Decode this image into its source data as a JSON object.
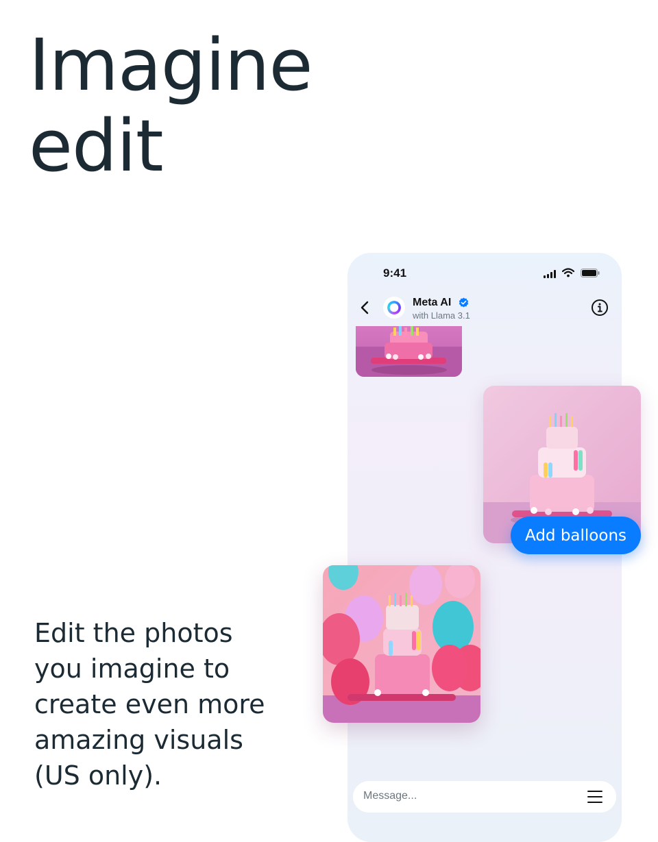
{
  "headline": {
    "line1": "Imagine",
    "line2": "edit"
  },
  "tagline": {
    "lines": [
      "Edit the photos",
      "you imagine to",
      "create even more",
      "amazing visuals",
      "(US only)."
    ]
  },
  "phone": {
    "status_bar": {
      "time": "9:41",
      "icons": [
        "signal-icon",
        "wifi-icon",
        "battery-icon"
      ]
    },
    "chat_header": {
      "contact_name": "Meta AI",
      "contact_subtitle": "with Llama 3.1",
      "verified": true,
      "icons": [
        "back-icon",
        "meta-ai-avatar",
        "verified-icon",
        "info-icon"
      ]
    },
    "messages": [
      {
        "from": "ai",
        "type": "image",
        "subject": "birthday cake"
      },
      {
        "from": "user",
        "type": "image",
        "subject": "birthday cake"
      },
      {
        "from": "user",
        "type": "text",
        "text": "Add balloons"
      },
      {
        "from": "ai",
        "type": "image",
        "subject": "birthday cake with balloons"
      }
    ],
    "composer": {
      "placeholder": "Message...",
      "icon": "menu-icon"
    }
  },
  "colors": {
    "text": "#1c2b33",
    "bubble": "#0a7cff",
    "verified": "#0a7cff"
  }
}
